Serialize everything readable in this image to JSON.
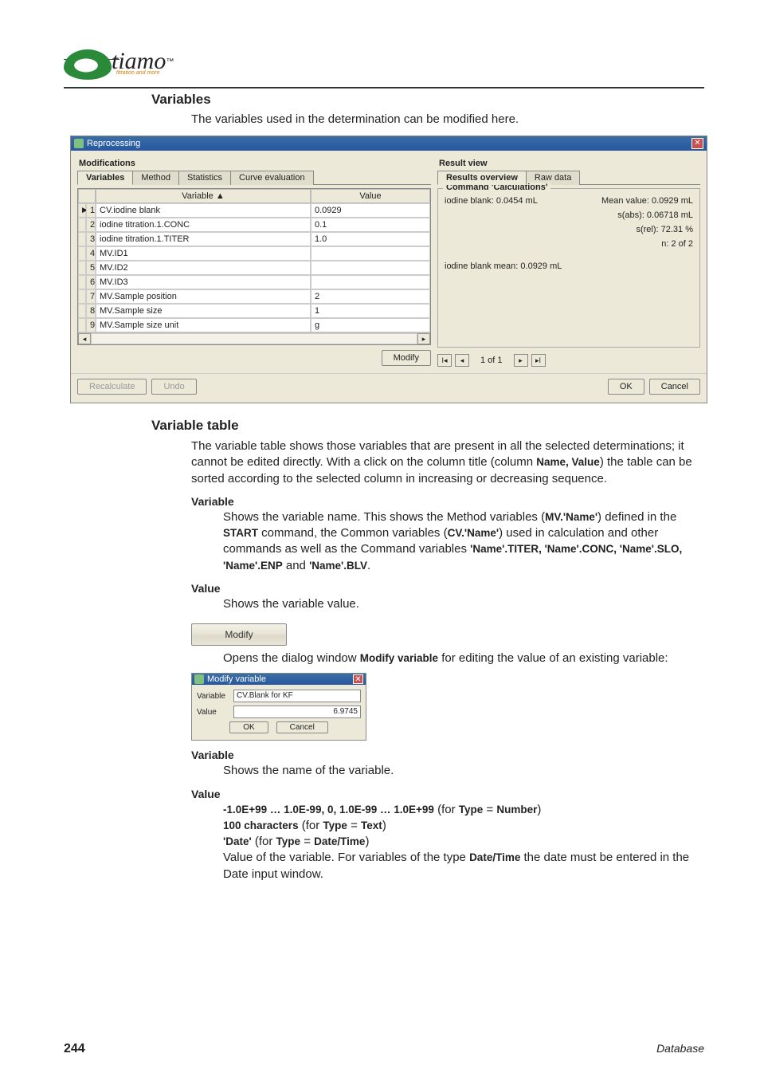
{
  "logo": {
    "text": "tiamo",
    "tm": "™",
    "sub": "titration and more"
  },
  "sections": {
    "variables": "Variables",
    "intro": "The variables used in the determination can be modified here.",
    "variable_table": "Variable table"
  },
  "window": {
    "title": "Reprocessing",
    "modifications_label": "Modifications",
    "result_view_label": "Result view",
    "tabs_left": [
      "Variables",
      "Method",
      "Statistics",
      "Curve evaluation"
    ],
    "tabs_right": [
      "Results overview",
      "Raw data"
    ],
    "grid_headers": {
      "variable": "Variable ▲",
      "value": "Value"
    },
    "rows": [
      {
        "idx": "1",
        "ptr": "▶",
        "var": "CV.iodine blank",
        "val": "0.0929"
      },
      {
        "idx": "2",
        "ptr": "",
        "var": "iodine titration.1.CONC",
        "val": "0.1"
      },
      {
        "idx": "3",
        "ptr": "",
        "var": "iodine titration.1.TITER",
        "val": "1.0"
      },
      {
        "idx": "4",
        "ptr": "",
        "var": "MV.ID1",
        "val": ""
      },
      {
        "idx": "5",
        "ptr": "",
        "var": "MV.ID2",
        "val": ""
      },
      {
        "idx": "6",
        "ptr": "",
        "var": "MV.ID3",
        "val": ""
      },
      {
        "idx": "7",
        "ptr": "",
        "var": "MV.Sample position",
        "val": "2"
      },
      {
        "idx": "8",
        "ptr": "",
        "var": "MV.Sample size",
        "val": "1"
      },
      {
        "idx": "9",
        "ptr": "",
        "var": "MV.Sample size unit",
        "val": "g"
      }
    ],
    "modify_btn": "Modify",
    "group_title": "Command 'Calculations'",
    "results": {
      "line1_left": "iodine blank:  0.0454 mL",
      "line1_right": "Mean value:  0.0929 mL",
      "sabs": "s(abs):  0.06718 mL",
      "srel": "s(rel):  72.31 %",
      "n": "n:  2 of 2",
      "mean_line": "iodine blank mean:  0.0929 mL"
    },
    "pager": "1 of 1",
    "bottom": {
      "recalc": "Recalculate",
      "undo": "Undo",
      "ok": "OK",
      "cancel": "Cancel"
    }
  },
  "body": {
    "vt_para": "The variable table shows those variables that are present in all the selected determinations; it cannot be edited directly. With a click on the column title (column ",
    "vt_cols": "Name, Value",
    "vt_para2": ") the table can be sorted according to the selected column in increasing or decreasing sequence.",
    "var_h": "Variable",
    "var_p1": "Shows the variable name. This shows the Method variables (",
    "var_mv": "MV.'Name'",
    "var_p2": ") defined in the ",
    "var_start": "START",
    "var_p3": " command, the Common variables (",
    "var_cv": "CV.'Name'",
    "var_p4": ") used in calculation and other commands as well as the Command variables ",
    "var_cmds": "'Name'.TITER, 'Name'.CONC, 'Name'.SLO, 'Name'.ENP",
    "var_and": " and ",
    "var_blv": "'Name'.BLV",
    "value_h": "Value",
    "value_p": "Shows the variable value.",
    "modify_graphic_label": "Modify",
    "modify_p": "Opens the dialog window ",
    "modify_b": "Modify variable",
    "modify_p2": " for editing the value of an existing variable:",
    "dlg": {
      "title": "Modify variable",
      "var_label": "Variable",
      "var_value": "CV.Blank for KF",
      "val_label": "Value",
      "val_value": "6.9745",
      "ok": "OK",
      "cancel": "Cancel"
    },
    "var2_h": "Variable",
    "var2_p": "Shows the name of the variable.",
    "val2_h": "Value",
    "val2_l1a": "-1.0E+99 … 1.0E-99, 0, 1.0E-99 … 1.0E+99",
    "val2_l1b": " (for ",
    "val2_type": "Type",
    "val2_eq": " = ",
    "val2_num": "Number",
    "val2_l2a": "100 characters",
    "val2_text": "Text",
    "val2_l3a": "'Date'",
    "val2_dt": "Date/Time",
    "val2_p": "Value of the variable. For variables of the type ",
    "val2_p2": " the date must be entered in the Date input window."
  },
  "footer": {
    "page": "244",
    "section": "Database"
  }
}
